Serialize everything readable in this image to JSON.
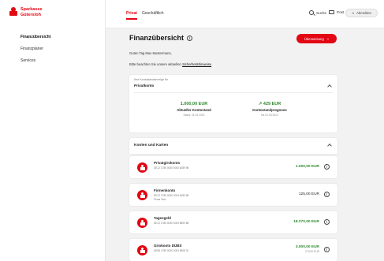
{
  "brand": {
    "line1": "Sparkasse",
    "line2": "Gütersloh"
  },
  "sidebar": {
    "items": [
      {
        "label": "Finanzübersicht",
        "active": true
      },
      {
        "label": "Finanzplaner",
        "active": false
      },
      {
        "label": "Services",
        "active": false
      }
    ]
  },
  "topbar": {
    "tabs": [
      {
        "label": "Privat",
        "active": true
      },
      {
        "label": "Geschäftlich",
        "active": false
      }
    ],
    "search_label": "Suche",
    "mail_label": "Post",
    "logout_label": "Abmelden"
  },
  "main": {
    "title": "Finanzübersicht",
    "info_glyph": "i",
    "action_button": "Überweisung",
    "action_plus": "+",
    "greeting": "Guten Tag Max Mustermann,",
    "hint_prefix": "Bitte beachten Sie unsere aktuellen",
    "hint_link": "Sicherheitshinweise",
    "account_selector": {
      "label": "Ihre Kontostandanzeige für",
      "value": "Privatkonto"
    },
    "stats": [
      {
        "amount": "1.000,00 EUR",
        "title": "Aktueller Kontostand",
        "date": "Stand: 01.03.2022"
      },
      {
        "amount": "↗ 429 EUR",
        "title": "Kontostandprognose",
        "date": "bis 31.03.2022"
      }
    ],
    "accounts_section_title": "Konten und Karten",
    "accounts": [
      {
        "name": "Privatgirokonto",
        "iban": "DE12 1785 0030 0003 6289 98",
        "note": "",
        "balance": "1.000,00 EUR",
        "positive": true,
        "sub": ""
      },
      {
        "name": "Firmenkonto",
        "iban": "DE12 1785 0030 0003 6289 88",
        "note": "Firma Test",
        "balance": "125,00 EUR",
        "positive": false,
        "sub": ""
      },
      {
        "name": "Tagesgeld",
        "iban": "DE12 1785 0030 0003 6899 88",
        "note": "",
        "balance": "18.270,00 EUR",
        "positive": true,
        "sub": ""
      },
      {
        "name": "Girokonto DÜBS",
        "iban": "DE86 1785 0030 0003 8908 32",
        "note": "",
        "balance": "3.000,00 EUR",
        "positive": true,
        "sub": "273,00 EUR"
      }
    ]
  },
  "colors": {
    "brand_red": "#e30613",
    "positive_green": "#2e8b2e"
  }
}
